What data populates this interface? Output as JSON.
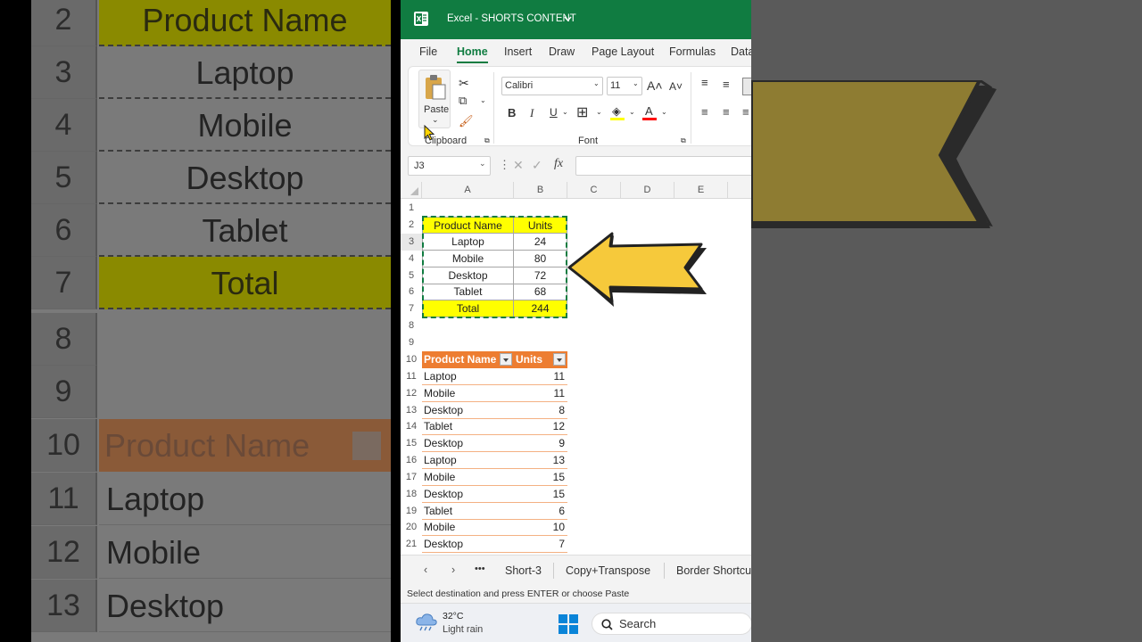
{
  "app": {
    "title": "Excel - SHORTS CONTENT",
    "menu": [
      "File",
      "Home",
      "Insert",
      "Draw",
      "Page Layout",
      "Formulas",
      "Data"
    ],
    "active_menu": "Home",
    "accent": "#107c41"
  },
  "ribbon": {
    "paste_label": "Paste",
    "clipboard_label": "Clipboard",
    "font_label": "Font",
    "font_name": "Calibri",
    "font_size": "11"
  },
  "formula": {
    "namebox": "J3",
    "fx": "fx"
  },
  "grid": {
    "columns": [
      "A",
      "B",
      "C",
      "D",
      "E"
    ],
    "rows": [
      "1",
      "2",
      "3",
      "4",
      "5",
      "6",
      "7",
      "8",
      "9",
      "10",
      "11",
      "12",
      "13",
      "14",
      "15",
      "16",
      "17",
      "18",
      "19",
      "20",
      "21"
    ],
    "summary": {
      "header": [
        "Product Name",
        "Units"
      ],
      "rows": [
        [
          "Laptop",
          "24"
        ],
        [
          "Mobile",
          "80"
        ],
        [
          "Desktop",
          "72"
        ],
        [
          "Tablet",
          "68"
        ]
      ],
      "total": [
        "Total",
        "244"
      ]
    },
    "table": {
      "header": [
        "Product Name",
        "Units"
      ],
      "rows": [
        [
          "Laptop",
          "11"
        ],
        [
          "Mobile",
          "11"
        ],
        [
          "Desktop",
          "8"
        ],
        [
          "Tablet",
          "12"
        ],
        [
          "Desktop",
          "9"
        ],
        [
          "Laptop",
          "13"
        ],
        [
          "Mobile",
          "15"
        ],
        [
          "Desktop",
          "15"
        ],
        [
          "Tablet",
          "6"
        ],
        [
          "Mobile",
          "10"
        ],
        [
          "Desktop",
          "7"
        ]
      ]
    }
  },
  "sheets": {
    "tabs": [
      "Short-3",
      "Copy+Transpose",
      "Border Shortcu"
    ],
    "more": "•••"
  },
  "status": {
    "message": "Select destination and press ENTER or choose Paste"
  },
  "taskbar": {
    "temp": "32°C",
    "weather": "Light rain",
    "search": "Search"
  },
  "background_zoom": {
    "rows": [
      {
        "num": "2",
        "text": "Product Name"
      },
      {
        "num": "3",
        "text": "Laptop"
      },
      {
        "num": "4",
        "text": "Mobile"
      },
      {
        "num": "5",
        "text": "Desktop"
      },
      {
        "num": "6",
        "text": "Tablet"
      },
      {
        "num": "7",
        "text": "Total"
      },
      {
        "num": "8",
        "text": ""
      },
      {
        "num": "9",
        "text": ""
      },
      {
        "num": "10",
        "text": "Product Name"
      },
      {
        "num": "11",
        "text": "Laptop"
      },
      {
        "num": "12",
        "text": "Mobile"
      },
      {
        "num": "13",
        "text": "Desktop"
      }
    ]
  }
}
